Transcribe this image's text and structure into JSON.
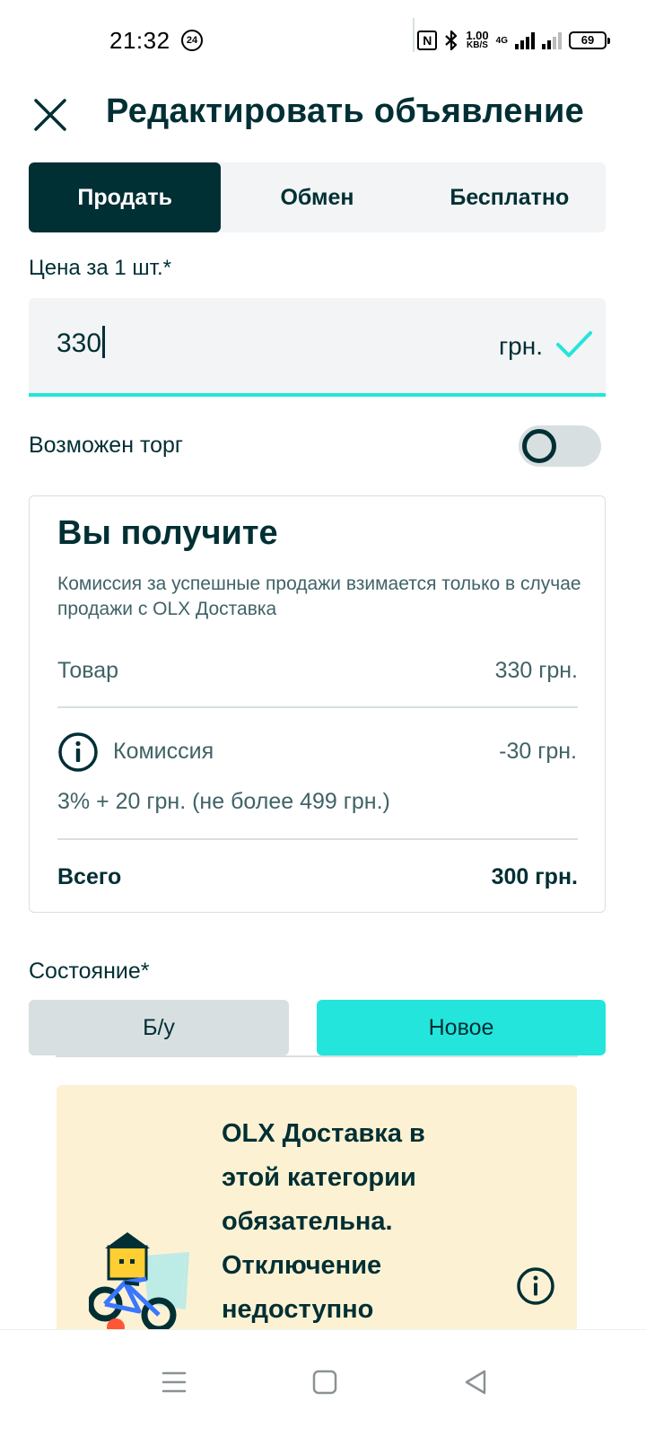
{
  "status_bar": {
    "time": "21:32",
    "notification_badge": "24",
    "nfc": "N",
    "speed_value": "1.00",
    "speed_unit": "KB/S",
    "network": "4G",
    "battery": "69"
  },
  "header": {
    "title": "Редактировать объявление",
    "close_icon": "close-icon"
  },
  "tabs": [
    {
      "label": "Продать",
      "active": true
    },
    {
      "label": "Обмен",
      "active": false
    },
    {
      "label": "Бесплатно",
      "active": false
    }
  ],
  "price": {
    "label": "Цена за 1 шт.*",
    "value": "330",
    "currency": "грн."
  },
  "negotiable": {
    "label": "Возможен торг",
    "enabled": false
  },
  "summary": {
    "title": "Вы получите",
    "note": "Комиссия за успешные продажи взимается только в случае продажи с OLX Доставка",
    "goods_label": "Товар",
    "goods_value": "330 грн.",
    "commission_label": "Комиссия",
    "commission_value": "-30 грн.",
    "commission_detail": "3% + 20 грн. (не более 499 грн.)",
    "total_label": "Всего",
    "total_value": "300 грн."
  },
  "condition": {
    "label": "Состояние*",
    "options": [
      {
        "label": "Б/у",
        "selected": false
      },
      {
        "label": "Новое",
        "selected": true
      }
    ]
  },
  "delivery_banner": {
    "text": "OLX Доставка в этой категории обязательна. Отключение недоступно"
  },
  "colors": {
    "primary": "#002f34",
    "accent": "#23e5db",
    "field_bg": "#f2f4f5",
    "banner_bg": "#fcf2d3",
    "muted_text": "#406367"
  }
}
